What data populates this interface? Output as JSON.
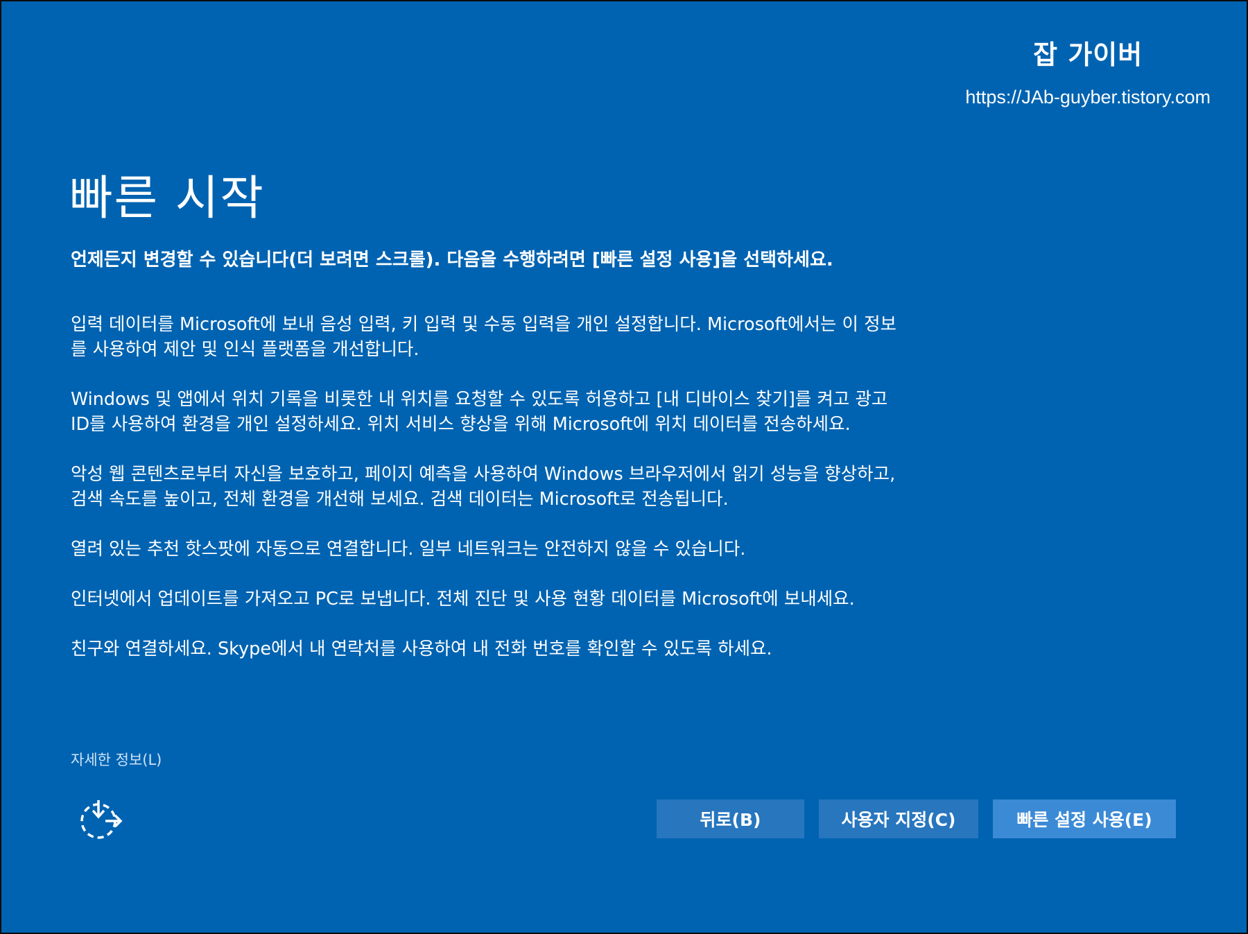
{
  "watermark": {
    "title": "잡 가이버",
    "url": "https://JAb-guyber.tistory.com"
  },
  "page": {
    "title": "빠른 시작",
    "lead": "언제든지 변경할 수 있습니다(더 보려면 스크롤). 다음을 수행하려면 [빠른 설정 사용]을 선택하세요.",
    "paragraphs": [
      "입력 데이터를 Microsoft에 보내 음성 입력, 키 입력 및 수동 입력을 개인 설정합니다. Microsoft에서는 이 정보를 사용하여 제안 및 인식 플랫폼을 개선합니다.",
      "Windows 및 앱에서 위치 기록을 비롯한 내 위치를 요청할 수 있도록 허용하고 [내 디바이스 찾기]를 켜고 광고 ID를 사용하여 환경을 개인 설정하세요. 위치 서비스 향상을 위해 Microsoft에 위치 데이터를 전송하세요.",
      "악성 웹 콘텐츠로부터 자신을 보호하고, 페이지 예측을 사용하여 Windows 브라우저에서 읽기 성능을 향상하고, 검색 속도를 높이고, 전체 환경을 개선해 보세요. 검색 데이터는 Microsoft로 전송됩니다.",
      "열려 있는 추천 핫스팟에 자동으로 연결합니다. 일부 네트워크는 안전하지 않을 수 있습니다.",
      "인터넷에서 업데이트를 가져오고 PC로 보냅니다. 전체 진단 및 사용 현황 데이터를 Microsoft에 보내세요.",
      "친구와 연결하세요. Skype에서 내 연락처를 사용하여 내 전화 번호를 확인할 수 있도록 하세요."
    ],
    "more_info": "자세한 정보(L)"
  },
  "buttons": {
    "back": "뒤로(B)",
    "customize": "사용자 지정(C)",
    "express": "빠른 설정 사용(E)"
  },
  "icons": {
    "ease_of_access": "ease-of-access-icon"
  },
  "colors": {
    "background": "#0063b1",
    "button": "#2776be",
    "primary_button": "#3b8ad6"
  }
}
